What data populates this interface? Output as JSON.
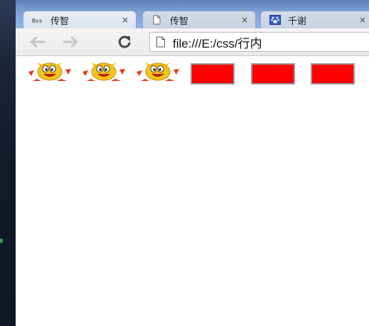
{
  "browser": {
    "tabs": [
      {
        "favicon": "Bvs-favicon",
        "favicon_text": "Bvs",
        "label": "传智",
        "close": "×"
      },
      {
        "favicon": "page-icon",
        "label": "传智",
        "close": "×"
      },
      {
        "favicon": "paw-favicon",
        "label": "千谢",
        "close": "×"
      }
    ],
    "toolbar": {
      "back": "back-arrow-icon",
      "forward": "forward-arrow-icon",
      "reload": "reload-icon"
    },
    "address_bar": {
      "icon": "page-icon",
      "url": "file:///E:/css/行内"
    }
  },
  "content": {
    "sprites": [
      {
        "icon": "cartoon-star-character-icon"
      },
      {
        "icon": "cartoon-star-character-icon"
      },
      {
        "icon": "cartoon-star-character-icon"
      }
    ],
    "boxes": [
      {
        "color": "#ff0000"
      },
      {
        "color": "#ff0000"
      },
      {
        "color": "#ff0000"
      }
    ]
  },
  "colors": {
    "titlebar": "#7aa0d8",
    "box_fill": "#ff0000",
    "box_border": "#9a9a9a"
  }
}
